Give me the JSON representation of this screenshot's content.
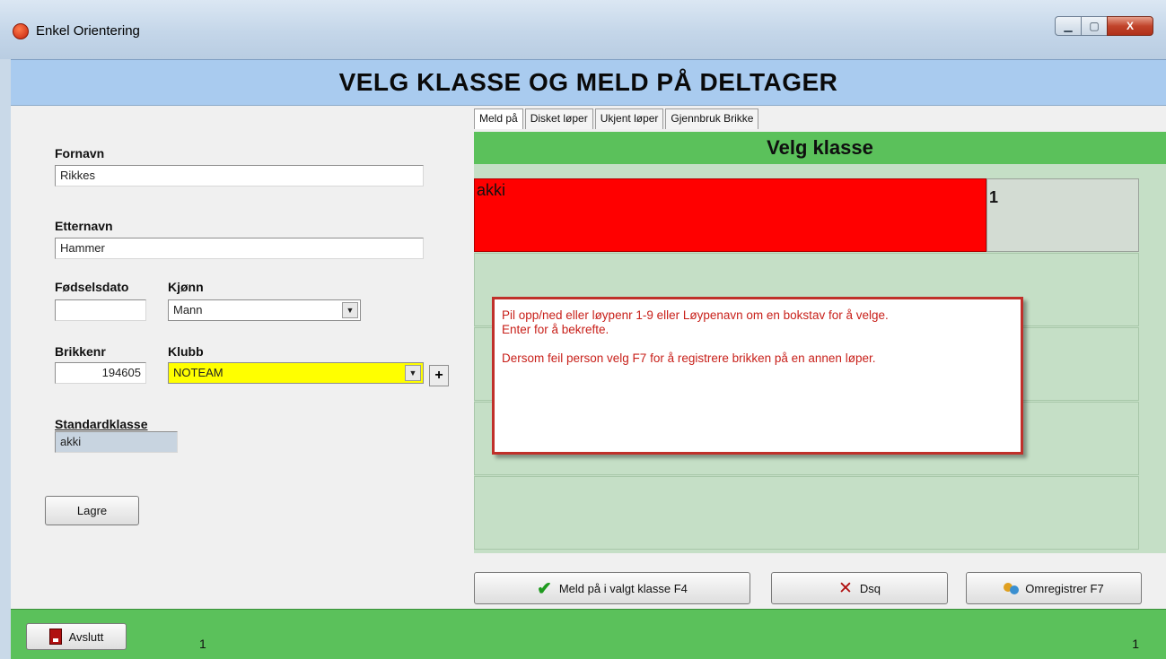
{
  "window": {
    "title": "Enkel Orientering",
    "min_symbol": "▁",
    "max_symbol": "▢",
    "close_symbol": "X"
  },
  "header": {
    "title": "VELG KLASSE OG MELD PÅ DELTAGER"
  },
  "form": {
    "first_name_label": "Fornavn",
    "first_name_value": "Rikkes",
    "last_name_label": "Etternavn",
    "last_name_value": "Hammer",
    "birthdate_label": "Fødselsdato",
    "birthdate_value": "",
    "gender_label": "Kjønn",
    "gender_value": "Mann",
    "chip_label": "Brikkenr",
    "chip_value": "194605",
    "club_label": "Klubb",
    "club_value": "NOTEAM",
    "add_club_label": "+",
    "default_class_label": "Standardklasse",
    "default_class_value": "akki",
    "save_label": "Lagre"
  },
  "tabs": [
    {
      "label": "Meld på"
    },
    {
      "label": "Disket løper"
    },
    {
      "label": "Ukjent løper"
    },
    {
      "label": "Gjennbruk Brikke"
    }
  ],
  "class_panel": {
    "title": "Velg klasse",
    "selected_class": {
      "name": "akki",
      "number": "1"
    }
  },
  "popup": {
    "line1": "Pil opp/ned  eller løypenr 1-9 eller Løypenavn om en bokstav for å velge.",
    "line2": "Enter for å bekrefte.",
    "line3": "Dersom feil person velg F7 for å registrere brikken på en annen løper."
  },
  "actions": {
    "register_label": "Meld på i valgt klasse F4",
    "dsq_label": "Dsq",
    "reregister_label": "Omregistrer F7",
    "check_glyph": "✔",
    "x_glyph": "✕"
  },
  "statusbar": {
    "exit_label": "Avslutt",
    "left_count": "1",
    "right_count": "1"
  },
  "colors": {
    "header_bg": "#a9cbef",
    "green": "#5bc15b",
    "selected_row": "#ff0000",
    "club_highlight": "#ffff00",
    "popup_text": "#c8201a"
  }
}
